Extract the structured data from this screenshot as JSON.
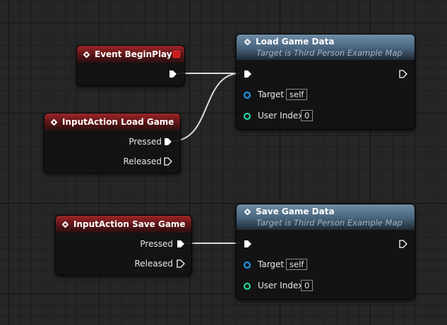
{
  "nodes": {
    "begin_play": {
      "title": "Event BeginPlay"
    },
    "input_load": {
      "title": "InputAction Load Game",
      "pressed": "Pressed",
      "released": "Released"
    },
    "input_save": {
      "title": "InputAction Save Game",
      "pressed": "Pressed",
      "released": "Released"
    },
    "load_data": {
      "title": "Load Game Data",
      "subtitle": "Target is Third Person Example Map",
      "target_label": "Target",
      "target_value": "self",
      "user_index_label": "User Index",
      "user_index_value": "0"
    },
    "save_data": {
      "title": "Save Game Data",
      "subtitle": "Target is Third Person Example Map",
      "target_label": "Target",
      "target_value": "self",
      "user_index_label": "User Index",
      "user_index_value": "0"
    }
  },
  "colors": {
    "event_header": "#9d2627",
    "function_header": "#6f8da6",
    "object_pin": "#1aa3ff",
    "integer_pin": "#1fe5b0",
    "exec_wire": "#ffffff",
    "delegate_pin": "#c81818"
  },
  "icons": {
    "node_icon": "diamond-icon",
    "exec_pin": "exec-arrow-icon",
    "delegate_pin": "delegate-square-icon"
  }
}
